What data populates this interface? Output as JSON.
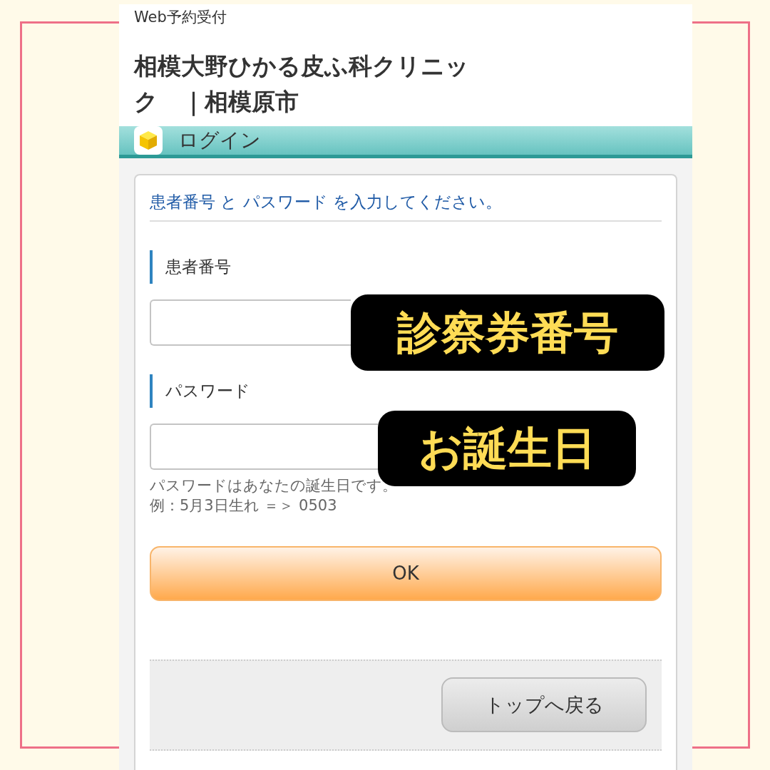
{
  "header": {
    "subtitle": "Web予約受付",
    "title": "相模大野ひかる皮ふ科クリニック　｜相模原市"
  },
  "section_bar": {
    "title": "ログイン"
  },
  "form": {
    "instruction": "患者番号 と パスワード を入力してください。",
    "fields": [
      {
        "label": "患者番号"
      },
      {
        "label": "パスワード",
        "help": [
          "パスワードはあなたの誕生日です。",
          "例：5月3日生れ ＝＞ 0503"
        ]
      }
    ],
    "submit": "OK"
  },
  "footer": {
    "back_button": "トップへ戻る"
  },
  "callouts": [
    "診察券番号",
    "お誕生日"
  ]
}
